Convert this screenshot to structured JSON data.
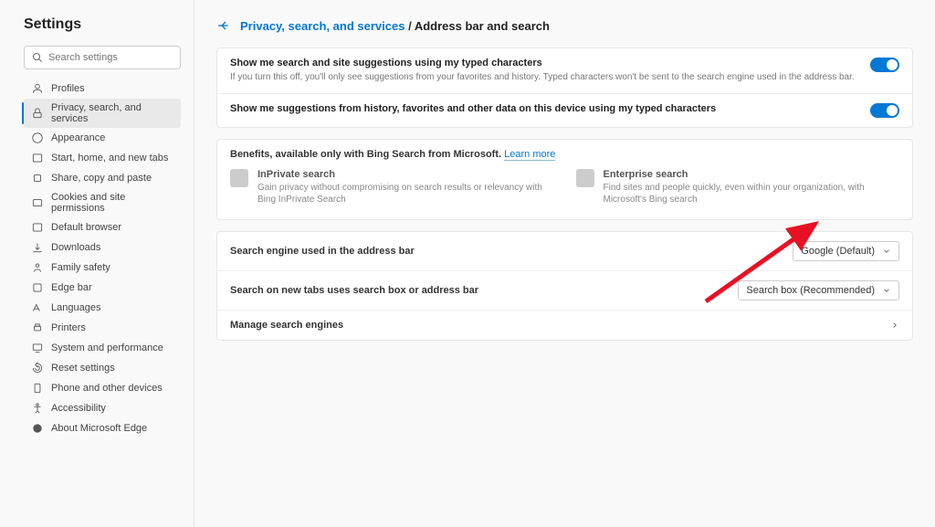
{
  "sidebar": {
    "title": "Settings",
    "search_placeholder": "Search settings",
    "items": [
      {
        "label": "Profiles",
        "active": false
      },
      {
        "label": "Privacy, search, and services",
        "active": true
      },
      {
        "label": "Appearance",
        "active": false
      },
      {
        "label": "Start, home, and new tabs",
        "active": false
      },
      {
        "label": "Share, copy and paste",
        "active": false
      },
      {
        "label": "Cookies and site permissions",
        "active": false
      },
      {
        "label": "Default browser",
        "active": false
      },
      {
        "label": "Downloads",
        "active": false
      },
      {
        "label": "Family safety",
        "active": false
      },
      {
        "label": "Edge bar",
        "active": false
      },
      {
        "label": "Languages",
        "active": false
      },
      {
        "label": "Printers",
        "active": false
      },
      {
        "label": "System and performance",
        "active": false
      },
      {
        "label": "Reset settings",
        "active": false
      },
      {
        "label": "Phone and other devices",
        "active": false
      },
      {
        "label": "Accessibility",
        "active": false
      },
      {
        "label": "About Microsoft Edge",
        "active": false
      }
    ]
  },
  "breadcrumb": {
    "parent": "Privacy, search, and services",
    "sep": " / ",
    "current": "Address bar and search"
  },
  "section1": {
    "row1_title": "Show me search and site suggestions using my typed characters",
    "row1_sub": "If you turn this off, you'll only see suggestions from your favorites and history. Typed characters won't be sent to the search engine used in the address bar.",
    "row2_title": "Show me suggestions from history, favorites and other data on this device using my typed characters"
  },
  "benefits": {
    "head": "Benefits, available only with Bing Search from Microsoft.",
    "learn": "Learn more",
    "b1_title": "InPrivate search",
    "b1_desc": "Gain privacy without compromising on search results or relevancy with Bing InPrivate Search",
    "b2_title": "Enterprise search",
    "b2_desc": "Find sites and people quickly, even within your organization, with Microsoft's Bing search"
  },
  "section3": {
    "row1_label": "Search engine used in the address bar",
    "row1_value": "Google (Default)",
    "row2_label": "Search on new tabs uses search box or address bar",
    "row2_value": "Search box (Recommended)",
    "manage": "Manage search engines"
  }
}
